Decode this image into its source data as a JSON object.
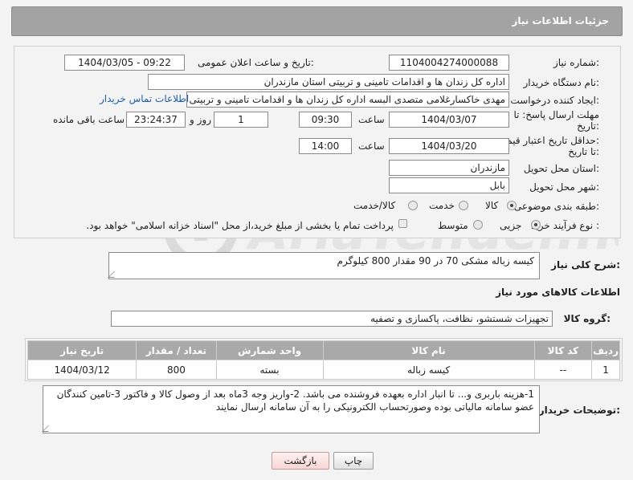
{
  "header": {
    "title": "جزئیات اطلاعات نیاز"
  },
  "form": {
    "need_number_label": "شماره نیاز:",
    "need_number": "1104004274000088",
    "announce_label": "تاریخ و ساعت اعلان عمومی:",
    "announce_value": "1404/03/05 - 09:22",
    "buyer_org_label": "نام دستگاه خریدار:",
    "buyer_org": "اداره کل زندان ها و اقدامات تامینی و تربیتی استان مازندران",
    "creator_label": "ایجاد کننده درخواست:",
    "creator": "مهدی خاکسارغلامی متصدی البسه اداره کل زندان ها و اقدامات تامینی و تربیتی",
    "contact_link": "اطلاعات تماس خریدار",
    "deadline_label_1": "مهلت ارسال پاسخ: تا",
    "deadline_label_2": "تاریخ:",
    "deadline_date": "1404/03/07",
    "time_label": "ساعت",
    "deadline_time": "09:30",
    "days_value": "1",
    "days_label": "روز و",
    "remaining_time": "23:24:37",
    "remaining_label": "ساعت باقی مانده",
    "validity_label_1": "حداقل تاریخ اعتبار قیمت:",
    "validity_label_2": "تا تاریخ:",
    "validity_date": "1404/03/20",
    "validity_time": "14:00",
    "province_label": "استان محل تحویل:",
    "province": "مازندران",
    "city_label": "شهر محل تحویل:",
    "city": "بابل",
    "category_label": "طبقه بندی موضوعی:",
    "category_options": [
      "کالا",
      "خدمت",
      "کالا/خدمت"
    ],
    "process_label": "نوع فرآیند خرید :",
    "process_options": [
      "جزیی",
      "متوسط"
    ],
    "payment_note": "پرداخت تمام یا بخشی از مبلغ خرید،از محل \"اسناد خزانه اسلامی\" خواهد بود."
  },
  "description": {
    "label": "شرح کلی نیاز:",
    "value": "کیسه زباله مشکی 70 در 90 مقدار 800 کیلوگرم"
  },
  "goods": {
    "section_title": "اطلاعات کالاهای مورد نیاز",
    "group_label": "گروه کالا:",
    "group_value": "تجهیزات شستشو، نظافت، پاکسازی و تصفیه"
  },
  "table": {
    "headers": [
      "ردیف",
      "کد کالا",
      "نام کالا",
      "واحد شمارش",
      "تعداد / مقدار",
      "تاریخ نیاز"
    ],
    "rows": [
      [
        "1",
        "--",
        "کیسه زباله",
        "بسته",
        "800",
        "1404/03/12"
      ]
    ]
  },
  "notes": {
    "label": "توضیحات خریدار:",
    "value": "1-هزینه باربری و... تا انبار اداره  بعهده فروشنده می باشد. 2-واریز وجه 3ماه بعد از وصول کالا و فاکتور 3-تامین کنندگان عضو سامانه مالیاتی بوده وصورتحساب الکترونیکی را به آن سامانه ارسال نمایند"
  },
  "buttons": {
    "print": "چاپ",
    "back": "بازگشت"
  },
  "watermark": {
    "text": "AriaTender.neT",
    "color": "#b0b0b0"
  }
}
